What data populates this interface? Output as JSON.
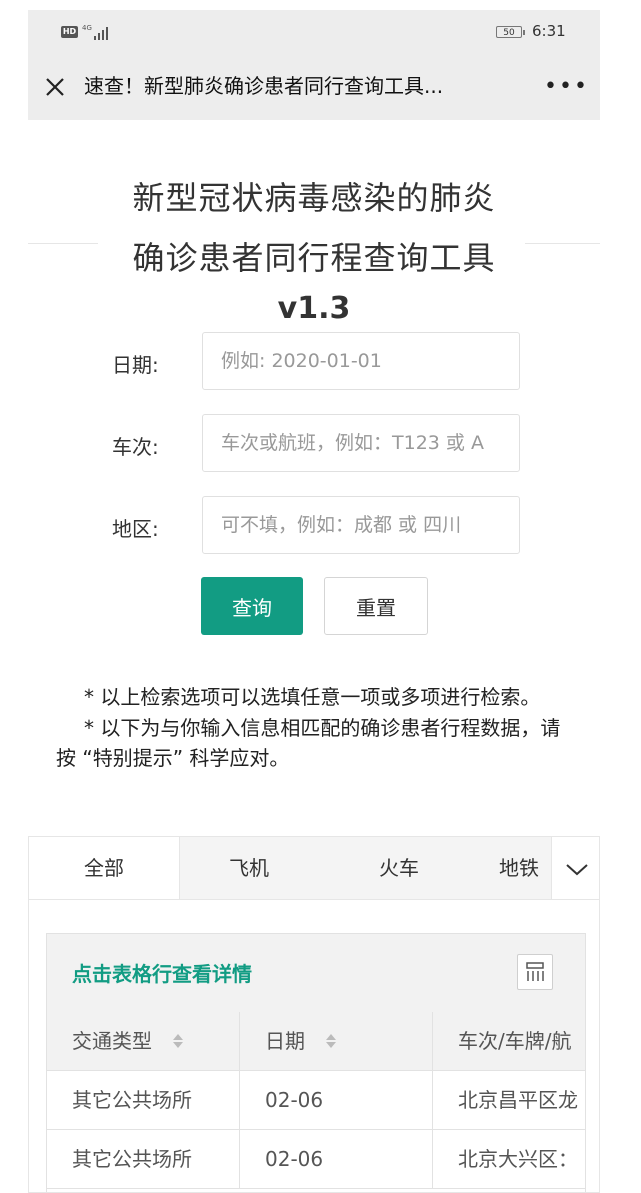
{
  "statusbar": {
    "hd": "HD",
    "network": "4G",
    "battery": "50",
    "time": "6:31"
  },
  "navbar": {
    "title": "速查！新型肺炎确诊患者同行查询工具..."
  },
  "title": {
    "line1": "新型冠状病毒感染的肺炎",
    "line2": "确诊患者同行程查询工具",
    "version": "v1.3"
  },
  "form": {
    "date_label": "日期:",
    "date_placeholder": "例如: 2020-01-01",
    "train_label": "车次:",
    "train_placeholder": "车次或航班，例如：T123 或 A",
    "area_label": "地区:",
    "area_placeholder": "可不填，例如：成都 或 四川",
    "query_button": "查询",
    "reset_button": "重置"
  },
  "notes": [
    "* 以上检索选项可以选填任意一项或多项进行检索。",
    "* 以下为与你输入信息相匹配的确诊患者行程数据，请按 “特别提示” 科学应对。"
  ],
  "tabs": [
    "全部",
    "飞机",
    "火车",
    "地铁"
  ],
  "table": {
    "hint": "点击表格行查看详情",
    "columns": [
      "交通类型",
      "日期",
      "车次/车牌/航"
    ],
    "rows": [
      [
        "其它公共场所",
        "02-06",
        "北京昌平区龙"
      ],
      [
        "其它公共场所",
        "02-06",
        "北京大兴区："
      ]
    ]
  },
  "colors": {
    "accent": "#129c83",
    "bar_bg": "#ededed",
    "border": "#e6e6e6"
  }
}
